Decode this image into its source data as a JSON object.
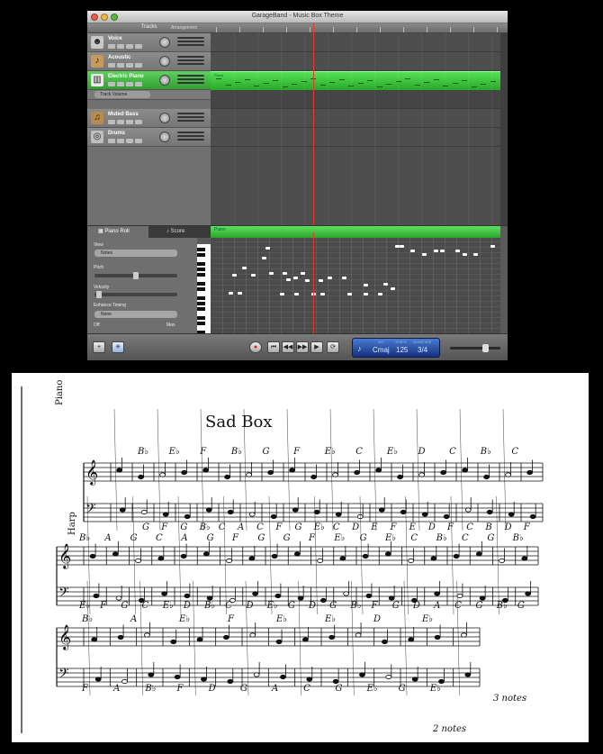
{
  "window": {
    "title": "GarageBand - Music Box Theme",
    "tracks_header": "Tracks",
    "arrange_label": "Arrangement"
  },
  "tracks": [
    {
      "name": "Voice",
      "icon": "voice-icon"
    },
    {
      "name": "Acoustic",
      "icon": "acoustic-guitar-icon"
    },
    {
      "name": "Electric Piano",
      "icon": "keyboard-icon",
      "selected": true
    },
    {
      "name": "Muted Bass",
      "icon": "bass-guitar-icon"
    },
    {
      "name": "Drums",
      "icon": "drums-icon"
    }
  ],
  "track_volume_label": "Track Volume",
  "region_label": "Piano",
  "editor": {
    "tab_piano_roll": "Piano Roll",
    "tab_score": "Score",
    "view_label": "View",
    "view_value": "Notes",
    "pitch_label": "Pitch",
    "velocity_label": "Velocity",
    "enhance_label": "Enhance Timing",
    "enhance_value": "None",
    "off_label": "Off",
    "max_label": "Max",
    "roll_label": "Piano"
  },
  "lcd": {
    "key_caption": "KEY",
    "tempo_caption": "TEMPO",
    "sig_caption": "SIGNATURE",
    "key": "Cmaj",
    "tempo": "125",
    "signature": "3/4"
  },
  "sheet": {
    "title": "Sad Box",
    "left_note_1": "Piano",
    "left_note_2": "Harp",
    "annotation_1": "3 notes",
    "annotation_2": "2 notes",
    "row1_chords": [
      "B♭",
      "E♭",
      "F",
      "B♭",
      "G",
      "F",
      "E♭",
      "C",
      "E♭",
      "D",
      "C",
      "B♭",
      "C"
    ],
    "row1_bass": [
      "G",
      "F",
      "G",
      "B♭",
      "C",
      "A",
      "C",
      "F",
      "G",
      "E♭",
      "C",
      "D",
      "E",
      "F",
      "E",
      "D",
      "F",
      "C",
      "B",
      "D",
      "F"
    ],
    "row2_chords": [
      "B♭",
      "A",
      "G",
      "C",
      "A",
      "G",
      "F",
      "G",
      "G",
      "F",
      "E♭",
      "G",
      "E♭",
      "C",
      "B♭",
      "C",
      "G",
      "B♭"
    ],
    "row2_bass": [
      "E♭",
      "F",
      "G",
      "C",
      "E♭",
      "D",
      "B♭",
      "C",
      "D",
      "E♭",
      "G",
      "D",
      "G",
      "B♭",
      "F",
      "G",
      "D",
      "A",
      "C",
      "G",
      "B♭",
      "G"
    ],
    "row3_chords": [
      "B♭",
      "A",
      "E♭",
      "F",
      "E♭",
      "E♭",
      "D",
      "E♭"
    ],
    "row3_bass": [
      "F",
      "A",
      "B♭",
      "F",
      "D",
      "G",
      "A",
      "C",
      "G",
      "E♭",
      "G",
      "E♭"
    ]
  }
}
